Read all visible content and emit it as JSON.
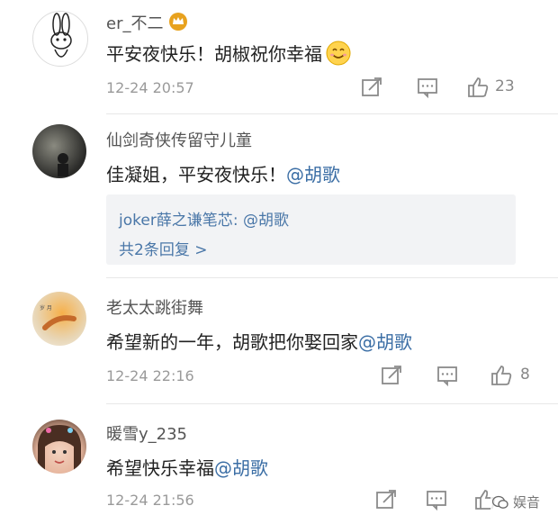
{
  "comments": [
    {
      "username": "er_不二",
      "text": "平安夜快乐！胡椒祝你幸福",
      "time": "12-24 20:57",
      "likes": "23",
      "has_crown": true,
      "avatar_icon": "rabbit-avatar"
    },
    {
      "username": "仙剑奇侠传留守儿童",
      "text_plain": "佳凝姐，平安夜快乐！",
      "mention": "@胡歌",
      "time": "",
      "likes": "",
      "replies": {
        "line1_user": "joker薛之谦笔芯",
        "line1_sep": ": ",
        "line1_mention": "@胡歌",
        "more": "共2条回复 >"
      }
    },
    {
      "username": "老太太跳街舞",
      "text_plain": "希望新的一年，胡歌把你娶回家",
      "mention": "@胡歌",
      "time": "12-24 22:16",
      "likes": "8"
    },
    {
      "username": "暖雪y_235",
      "text_plain": "希望快乐幸福",
      "mention": "@胡歌",
      "time": "12-24 21:56",
      "likes": ""
    }
  ],
  "watermark": "娱音",
  "colors": {
    "mention": "#3b6ea5",
    "crown": "#e8a21e",
    "name": "#555555",
    "time": "#9a9a9a"
  }
}
